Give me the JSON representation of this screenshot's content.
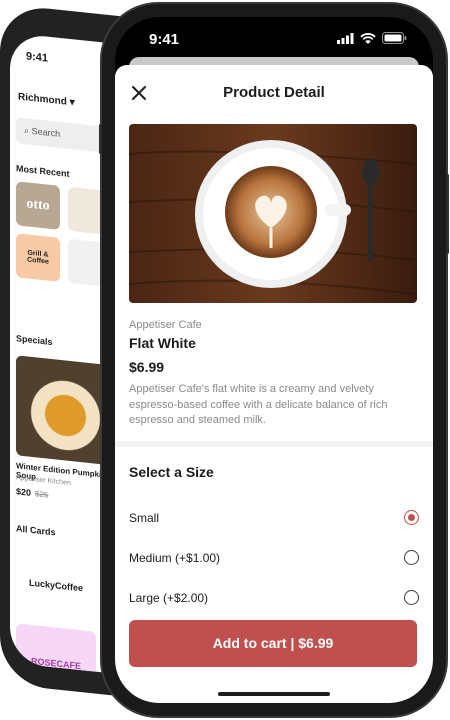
{
  "colors": {
    "accent": "#c0504d",
    "frame": "#1a1a1a"
  },
  "back_screen": {
    "time": "9:41",
    "location": "Richmond",
    "search_placeholder": "Search",
    "most_recent_heading": "Most Recent",
    "tiles": [
      "otto",
      "",
      "Grill & Coffee",
      ""
    ],
    "specials_heading": "Specials",
    "special": {
      "name": "Winter Edition Pumpkin Soup",
      "vendor": "Appetiser Kitchen",
      "price": "$20",
      "old_price": "$25"
    },
    "all_cards_heading": "All Cards",
    "cards": [
      "LuckyCoffee",
      "ROSECAFE"
    ]
  },
  "status_bar": {
    "time": "9:41"
  },
  "header": {
    "title": "Product Detail"
  },
  "product": {
    "vendor": "Appetiser Cafe",
    "name": "Flat White",
    "price": "$6.99",
    "description": "Appetiser Cafe's flat white is a creamy and velvety espresso-based coffee with a delicate balance of rich espresso and steamed milk."
  },
  "sizes": {
    "title": "Select a Size",
    "options": [
      {
        "label": "Small",
        "selected": true
      },
      {
        "label": "Medium (+$1.00)",
        "selected": false
      },
      {
        "label": "Large (+$2.00)",
        "selected": false
      }
    ]
  },
  "cart": {
    "label": "Add to cart | $6.99"
  }
}
